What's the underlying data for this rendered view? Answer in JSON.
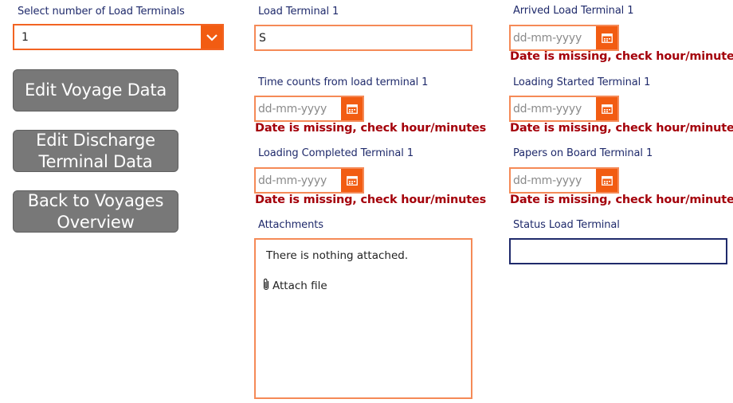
{
  "left": {
    "terminal_count": {
      "label": "Select number of Load Terminals",
      "value": "1"
    },
    "buttons": [
      {
        "label": "Edit Voyage Data"
      },
      {
        "label": "Edit Discharge Terminal Data"
      },
      {
        "label": "Back to Voyages Overview"
      }
    ]
  },
  "middle": {
    "load_terminal": {
      "label": "Load Terminal 1",
      "value": "S"
    },
    "time_counts": {
      "label": "Time counts from load terminal 1",
      "placeholder": "dd-mm-yyyy",
      "error": "Date is missing, check hour/minutes"
    },
    "loading_completed": {
      "label": "Loading Completed Terminal 1",
      "placeholder": "dd-mm-yyyy",
      "error": "Date is missing, check hour/minutes"
    },
    "attachments": {
      "label": "Attachments",
      "empty_text": "There is nothing attached.",
      "attach_label": "Attach file"
    }
  },
  "right": {
    "arrived": {
      "label": "Arrived Load Terminal 1",
      "placeholder": "dd-mm-yyyy",
      "error": "Date is missing, check hour/minutes"
    },
    "loading_started": {
      "label": "Loading Started Terminal 1",
      "placeholder": "dd-mm-yyyy",
      "error": "Date is missing, check hour/minutes"
    },
    "papers_on_board": {
      "label": "Papers on Board Terminal 1",
      "placeholder": "dd-mm-yyyy",
      "error": "Date is missing, check hour/minutes"
    },
    "status": {
      "label": "Status Load Terminal",
      "value": ""
    }
  },
  "icons": {
    "dropdown": "chevron-down-icon",
    "date": "calendar-icon",
    "attach": "paperclip-icon"
  },
  "colors": {
    "accent": "#f25c12",
    "input_border": "#f58a57",
    "label": "#1f2a6b",
    "error": "#a4000a",
    "button": "#787878"
  }
}
